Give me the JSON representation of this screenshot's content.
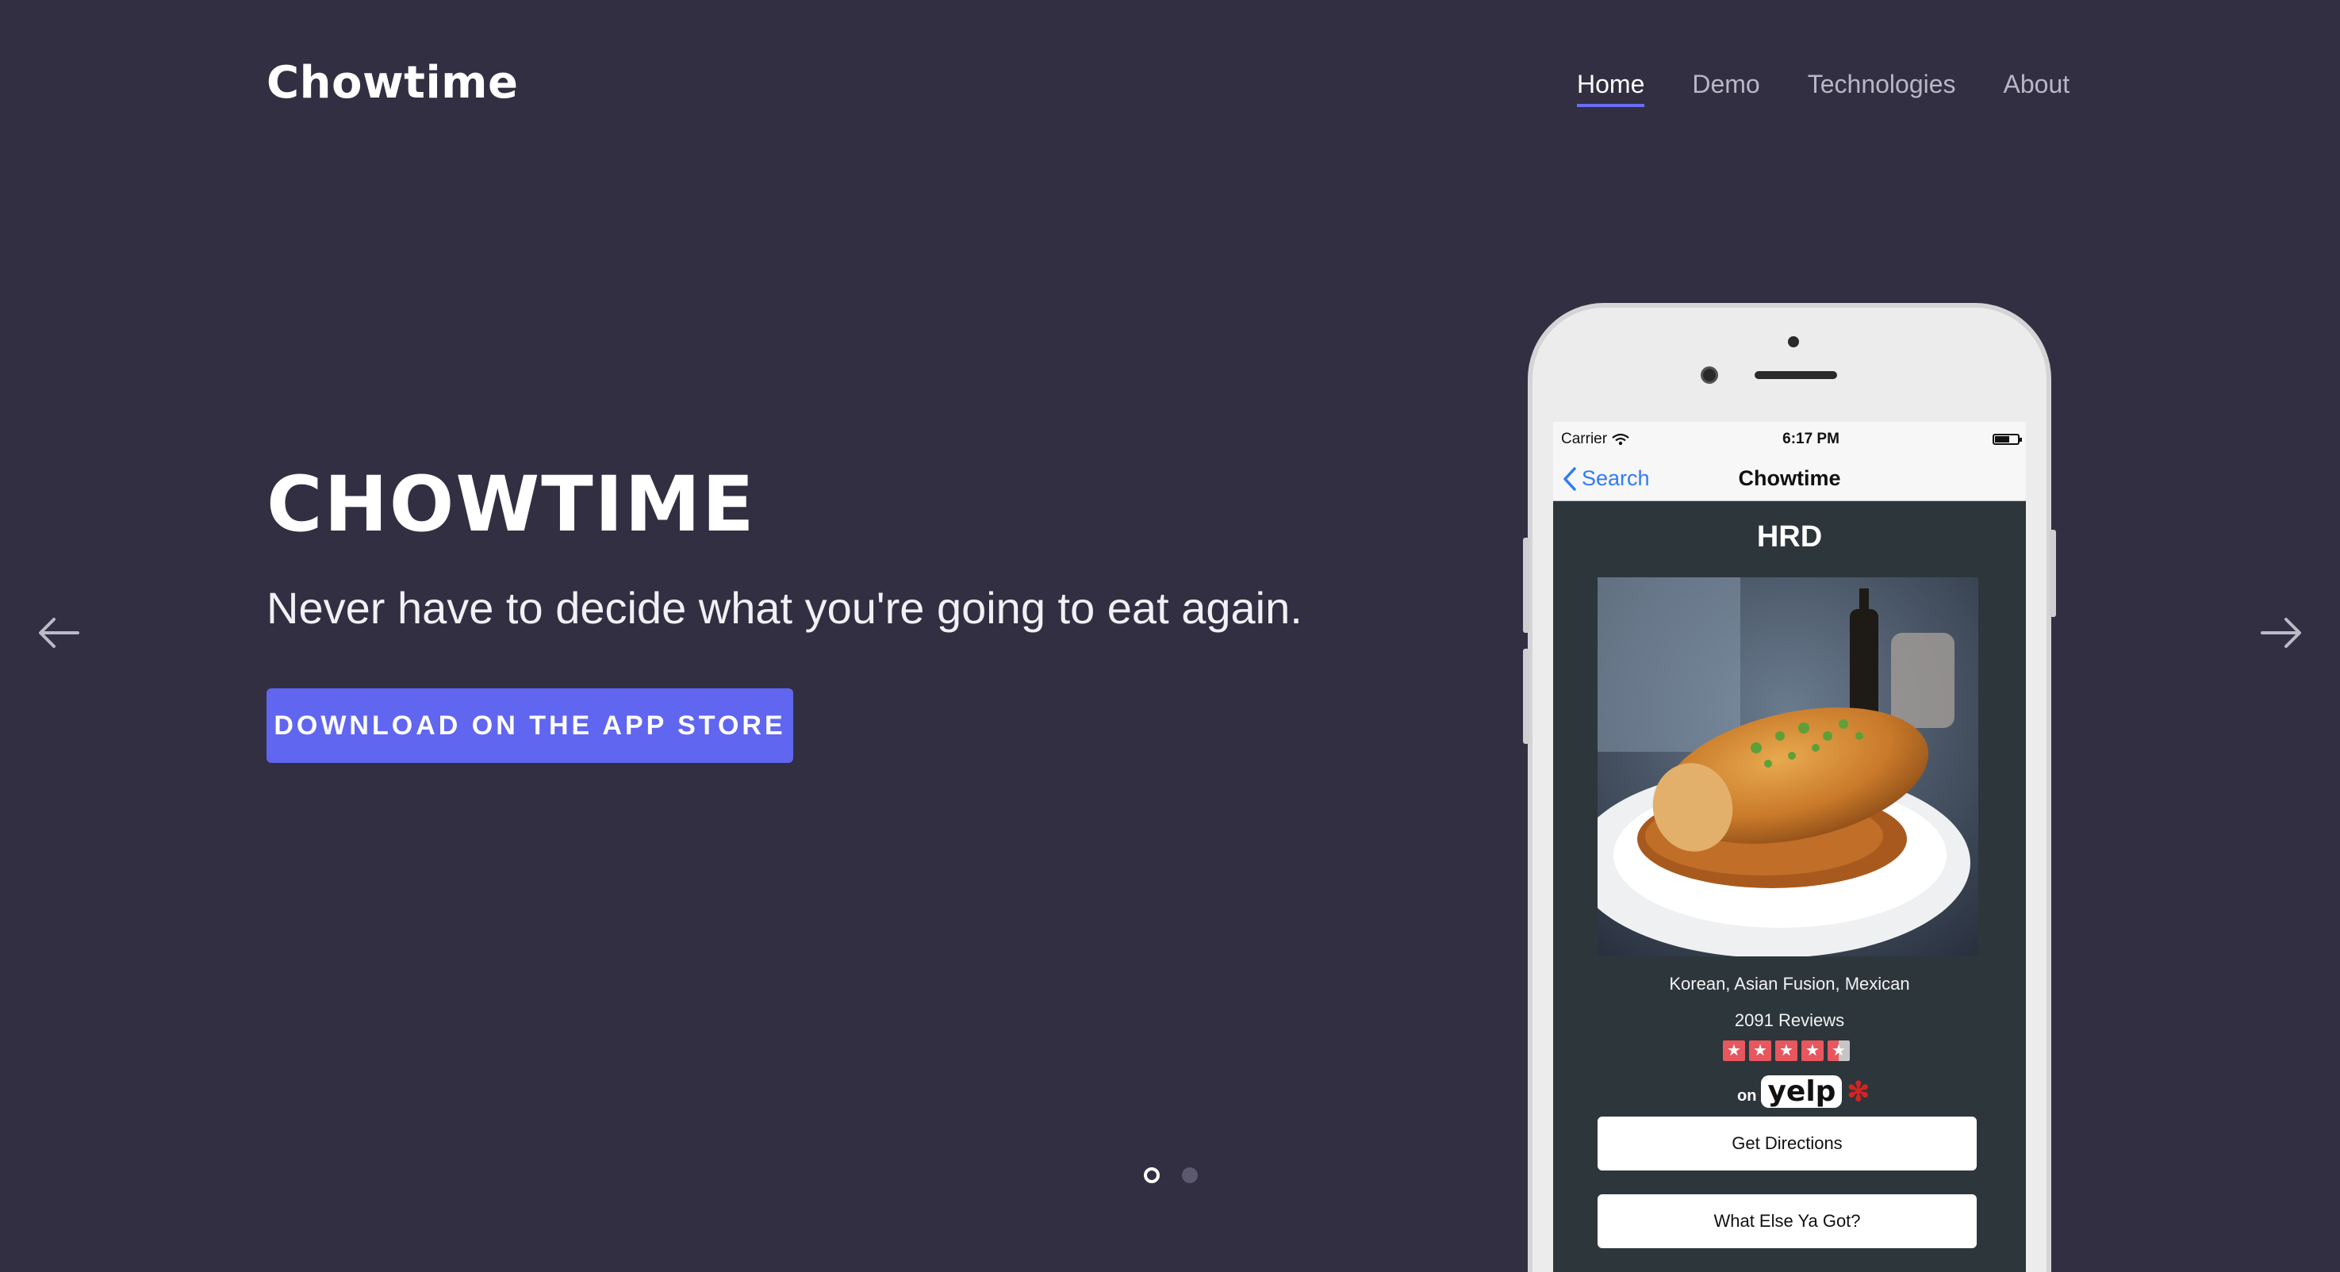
{
  "brand": "Chowtime",
  "nav": {
    "items": [
      {
        "label": "Home",
        "active": true
      },
      {
        "label": "Demo",
        "active": false
      },
      {
        "label": "Technologies",
        "active": false
      },
      {
        "label": "About",
        "active": false
      }
    ]
  },
  "hero": {
    "title": "CHOWTIME",
    "subtitle": "Never have to decide what you're going to eat again.",
    "cta_label": "DOWNLOAD ON THE APP STORE"
  },
  "carousel": {
    "prev_icon": "arrow-left-icon",
    "next_icon": "arrow-right-icon",
    "slide_count": 2,
    "active_index": 0
  },
  "phone": {
    "status": {
      "carrier": "Carrier",
      "time": "6:17 PM"
    },
    "navbar": {
      "back_label": "Search",
      "title": "Chowtime"
    },
    "restaurant": {
      "name": "HRD",
      "cuisine": "Korean, Asian Fusion, Mexican",
      "reviews": "2091 Reviews",
      "rating": 4.5,
      "yelp_on": "on",
      "yelp_logo": "yelp"
    },
    "buttons": {
      "directions": "Get Directions",
      "else": "What Else Ya Got?"
    }
  },
  "colors": {
    "background": "#332f42",
    "accent": "#6066ef",
    "app_dark": "#2d363b",
    "ios_blue": "#2f7bf5",
    "star_red": "#e7575d"
  }
}
